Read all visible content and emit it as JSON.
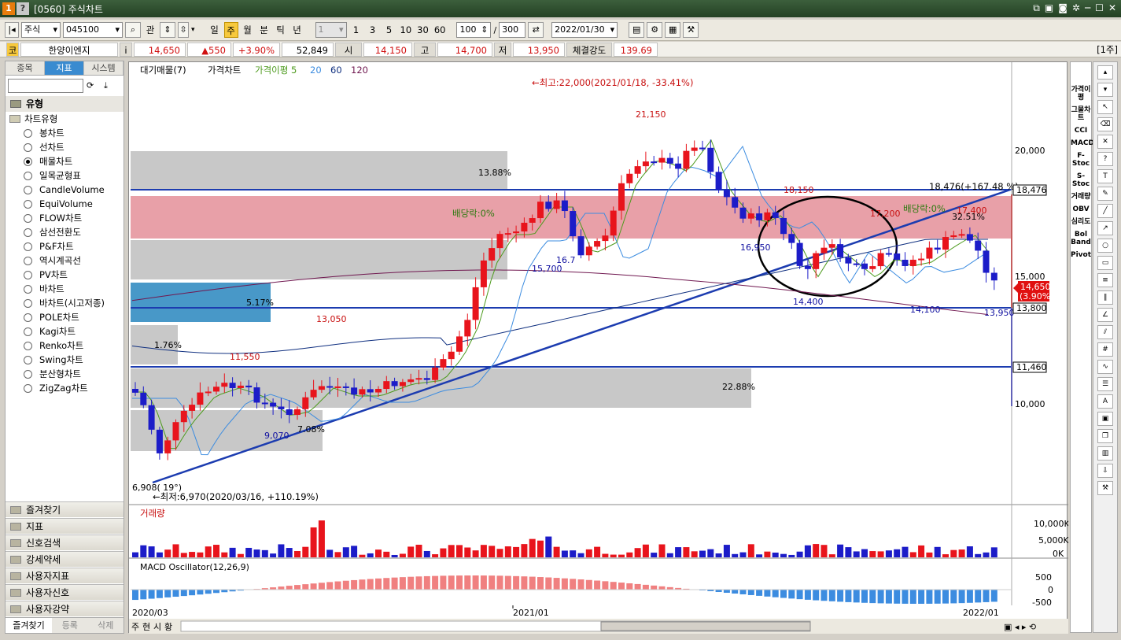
{
  "window": {
    "title": "[0560] 주식차트",
    "icons": [
      "1",
      "?"
    ]
  },
  "toolbar": {
    "market": "주식",
    "code": "045100",
    "btn_kwan": "관",
    "periods": [
      "일",
      "주",
      "월",
      "분",
      "틱",
      "년"
    ],
    "selected_period": "주",
    "unit_value": "1",
    "unit_buttons": [
      "1",
      "3",
      "5",
      "10",
      "30",
      "60"
    ],
    "count": "100",
    "total": "300",
    "date": "2022/01/30",
    "slash": "/"
  },
  "quote": {
    "flag": "코",
    "name": "한양이엔지",
    "info_btn": "i",
    "price": "14,650",
    "change": "▲550",
    "change_pct": "+3.90%",
    "volume": "52,849",
    "open_label": "시",
    "open": "14,150",
    "high_label": "고",
    "high": "14,700",
    "low_label": "저",
    "low": "13,950",
    "strength_label": "체결강도",
    "strength": "139.69",
    "week_label": "[1주]"
  },
  "left": {
    "tabs": [
      "종목",
      "지표",
      "시스템"
    ],
    "selected_tab": "지표",
    "group_title": "유형",
    "subgroup": "차트유형",
    "types": [
      "봉차트",
      "선차트",
      "매물차트",
      "일목균형표",
      "CandleVolume",
      "EquiVolume",
      "FLOW차트",
      "삼선전환도",
      "P&F차트",
      "역시계곡선",
      "PV차트",
      "바차트",
      "바차트(시고저종)",
      "POLE차트",
      "Kagi차트",
      "Renko차트",
      "Swing차트",
      "분산형차트",
      "ZigZag차트"
    ],
    "selected_type": "매물차트",
    "sections": [
      "즐겨찾기",
      "지표",
      "신호검색",
      "강세약세",
      "사용자지표",
      "사용자신호",
      "사용자강약"
    ],
    "bottom_tabs": [
      "즐겨찾기",
      "등록",
      "삭제"
    ]
  },
  "chart": {
    "legend": {
      "a": "대기매물(7)",
      "b": "가격차트",
      "c": "가격이평 5",
      "d": "20",
      "e": "60",
      "f": "120"
    },
    "annotations": {
      "high": "←최고:22,000(2021/01/18, -33.41%)",
      "low": "←최저:6,970(2020/03/16, +110.19%)",
      "trend": "18,476(+167.48 %)",
      "div1": "배당락:0%",
      "div2": "배당락:0%",
      "p21150": "21,150",
      "p18150": "18,150",
      "p17200": "17,200",
      "p17400": "17,400",
      "p16950": "16,950",
      "p16_7": "16.7",
      "p15700": "15,700",
      "p14400": "14,400",
      "p14100": "14,100",
      "p13950": "13,950",
      "p13050": "13,050",
      "p11550": "11,550",
      "p9070": "9,070",
      "p6908": "6,908( 19°)",
      "pct1388": "13.88%",
      "pct517": "5.17%",
      "pct176": "1.76%",
      "pct708": "7.08%",
      "pct2288": "22.88%",
      "pct3251": "32.51%"
    },
    "y_ticks": [
      "20,000",
      "15,000",
      "10,000"
    ],
    "price_tags": {
      "t1": "18,476",
      "t2": "13,800",
      "t3": "11,460",
      "cur1": "14,650",
      "cur2": "(3.90%)"
    },
    "volume": {
      "title": "거래량",
      "ticks": [
        "10,000K",
        "5,000K",
        "0K"
      ]
    },
    "macd": {
      "title": "MACD Oscillator(12,26,9)",
      "ticks": [
        "500",
        "0",
        "-500"
      ]
    },
    "x_labels": [
      "2020/03",
      "2021/01",
      "2022/01"
    ],
    "bottom_tabs": [
      "주",
      "현",
      "시",
      "황"
    ]
  },
  "right_tools": [
    "가격이평",
    "그물차트",
    "CCI",
    "MACD",
    "F-Stoc",
    "S-Stoc",
    "거래량",
    "OBV",
    "심리도",
    "Bol Band",
    "Pivot"
  ],
  "colors": {
    "up": "#e8141c",
    "down": "#1c1cc8",
    "ma5": "#4c9a1c",
    "ma20": "#3c8ce0",
    "ma60": "#103080",
    "ma120": "#701850",
    "band_red": "#e8a0a8",
    "band_grey": "#c8c8c8",
    "band_blue": "#4898c8"
  }
}
